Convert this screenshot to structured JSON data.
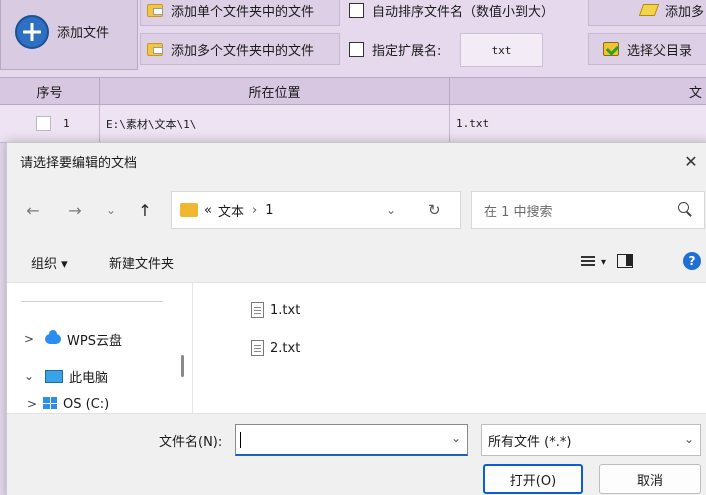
{
  "app": {
    "add_file_label": "添加文件",
    "toolbar": {
      "add_single_folder": "添加单个文件夹中的文件",
      "add_multi_folder": "添加多个文件夹中的文件",
      "auto_sort": "自动排序文件名（数值小到大）",
      "specify_ext_label": "指定扩展名:",
      "ext_value": "txt",
      "add_more": "添加多",
      "select_parent": "选择父目录"
    },
    "grid": {
      "headers": [
        "序号",
        "所在位置",
        "文"
      ],
      "rows": [
        {
          "index": "1",
          "location": "E:\\素材\\文本\\1\\",
          "name": "1.txt"
        }
      ]
    }
  },
  "dialog": {
    "title": "请选择要编辑的文档",
    "nav": {
      "back": "←",
      "forward": "→",
      "recent": "⌄",
      "up": "↑"
    },
    "address": {
      "overflow": "«",
      "path": [
        "文本",
        "1"
      ]
    },
    "search_placeholder": "在 1 中搜索",
    "commands": {
      "organize": "组织 ▾",
      "new_folder": "新建文件夹"
    },
    "tree": [
      {
        "label": "WPS云盘",
        "chevron": ">"
      },
      {
        "label": "此电脑",
        "chevron": "⌄"
      },
      {
        "label": "OS (C:)",
        "chevron": ">"
      }
    ],
    "files": [
      "1.txt",
      "2.txt"
    ],
    "filename_label": "文件名(N):",
    "filename_value": "",
    "filetype": "所有文件 (*.*)",
    "open_button": "打开(O)",
    "cancel_button": "取消"
  }
}
